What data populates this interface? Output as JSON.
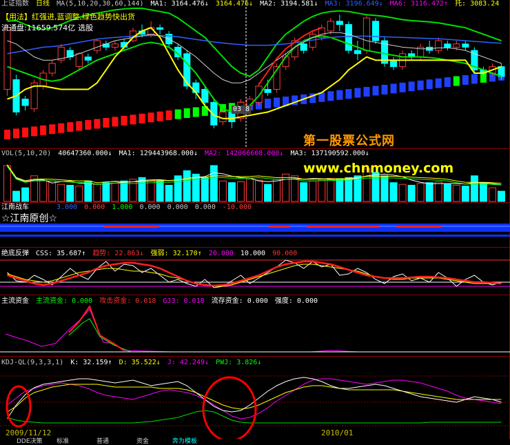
{
  "main": {
    "header_index": "上证指数",
    "header_period": "日线",
    "header_ma": "MA(5,10,20,30,60,144)",
    "ma1": "MA1: 3164.476↓",
    "ma1_value": "3164.476↓",
    "ma2": "MA2: 3194.581↓",
    "ma3": "MA3: 3196.649↓",
    "ma6": "MA6: 3116.472↑",
    "tuo": "托: 3083.24",
    "usage": "【用法】红强进,蓝调整,绿色趋势快出货",
    "float": "流通盘:11659.574亿",
    "select": "选股",
    "crosshair_label": "03 8"
  },
  "vol": {
    "label": "VOL(5,10,20)",
    "value": "40647360.000↓",
    "ma1": "MA1: 129443968.000↓",
    "ma2": "MA2: 142066608.000↓",
    "ma3": "MA3: 137190592.000↓"
  },
  "jiangnan": {
    "label": "江南战车",
    "values": [
      "3.000",
      "0.000",
      "1.000",
      "0.000",
      "0.000",
      "0.000",
      "-10.000"
    ],
    "subtitle": "☆江南原创☆"
  },
  "juedi": {
    "label": "绝底反弹",
    "css": "CSS: 35.687↑",
    "qushi": "趋势: 22.863↓",
    "qiangruo": "强弱: 32.170↑",
    "l1": "20.000",
    "l2": "10.000",
    "l3": "90.000"
  },
  "zhuliu": {
    "label": "主流资金",
    "zl": "主流资金: 0.000",
    "gj": "攻击资金: 0.018",
    "gj3": "GJ3: 0.018",
    "lc": "流存资金: 0.000",
    "qd": "强度: 0.000"
  },
  "kdj": {
    "label": "KDJ-QL(9,3,3,1)",
    "k": "K: 32.159↑",
    "d": "D: 35.522↓",
    "j": "J: 42.249↓",
    "pwj": "PWJ: 3.826↓"
  },
  "dates": [
    "2009/11/12",
    "2010/01"
  ],
  "watermark": {
    "name": "第一股票公式网",
    "url": "www.chnmoney.com"
  },
  "tabs": [
    "DDE决策",
    "标准",
    "普通",
    "资金",
    "奔为模板"
  ],
  "colors": {
    "up": "#ff3b3b",
    "down": "#00ffff",
    "ma_white": "#ffffff",
    "ma_yellow": "#ffff00",
    "ma_green": "#00e000",
    "ma_blue": "#3060ff",
    "border": "#8b0000"
  },
  "chart_data": [
    {
      "type": "candlestick",
      "title": "上证指数 日线",
      "candles": [
        [
          3050,
          3240,
          3030,
          3250
        ],
        [
          3080,
          2980,
          2970,
          3095
        ],
        [
          3020,
          3000,
          2985,
          3030
        ],
        [
          2990,
          3070,
          2980,
          3080
        ],
        [
          3060,
          3100,
          3050,
          3110
        ],
        [
          3100,
          3130,
          3090,
          3140
        ],
        [
          3140,
          3180,
          3130,
          3190
        ],
        [
          3170,
          3150,
          3140,
          3180
        ],
        [
          3120,
          3160,
          3110,
          3165
        ],
        [
          3150,
          3140,
          3130,
          3160
        ],
        [
          3170,
          3200,
          3160,
          3205
        ],
        [
          3190,
          3180,
          3170,
          3200
        ],
        [
          3180,
          3190,
          3170,
          3200
        ],
        [
          3195,
          3180,
          3170,
          3205
        ],
        [
          3200,
          3230,
          3195,
          3240
        ],
        [
          3230,
          3220,
          3210,
          3250
        ],
        [
          3220,
          3240,
          3210,
          3260
        ],
        [
          3240,
          3235,
          3220,
          3250
        ],
        [
          3220,
          3190,
          3180,
          3230
        ],
        [
          3180,
          3150,
          3140,
          3190
        ],
        [
          3160,
          3060,
          3050,
          3170
        ],
        [
          3070,
          3040,
          3020,
          3080
        ],
        [
          3050,
          3010,
          3000,
          3060
        ],
        [
          3010,
          2940,
          2930,
          3020
        ],
        [
          2950,
          2980,
          2940,
          2990
        ],
        [
          2980,
          2950,
          2930,
          3000
        ],
        [
          2960,
          3010,
          2950,
          3020
        ],
        [
          3000,
          3020,
          2990,
          3030
        ],
        [
          3010,
          3060,
          3000,
          3070
        ],
        [
          3050,
          3040,
          3030,
          3080
        ],
        [
          3050,
          3120,
          3040,
          3130
        ],
        [
          3120,
          3150,
          3110,
          3160
        ],
        [
          3150,
          3200,
          3140,
          3210
        ],
        [
          3190,
          3170,
          3160,
          3200
        ],
        [
          3180,
          3220,
          3170,
          3230
        ],
        [
          3210,
          3240,
          3200,
          3250
        ],
        [
          3230,
          3260,
          3220,
          3270
        ],
        [
          3260,
          3250,
          3230,
          3280
        ],
        [
          3250,
          3170,
          3160,
          3260
        ],
        [
          3170,
          3160,
          3140,
          3200
        ],
        [
          3170,
          3270,
          3160,
          3280
        ],
        [
          3260,
          3200,
          3190,
          3270
        ],
        [
          3200,
          3130,
          3120,
          3210
        ],
        [
          3140,
          3120,
          3110,
          3150
        ],
        [
          3120,
          3160,
          3110,
          3170
        ],
        [
          3160,
          3150,
          3140,
          3170
        ],
        [
          3150,
          3180,
          3140,
          3190
        ],
        [
          3180,
          3170,
          3160,
          3200
        ],
        [
          3170,
          3200,
          3160,
          3210
        ],
        [
          3190,
          3180,
          3170,
          3200
        ],
        [
          3180,
          3190,
          3170,
          3200
        ],
        [
          3190,
          3180,
          3170,
          3200
        ],
        [
          3170,
          3110,
          3100,
          3180
        ],
        [
          3110,
          3100,
          3090,
          3120
        ],
        [
          3100,
          3120,
          3090,
          3130
        ],
        [
          3120,
          3090,
          3080,
          3130
        ]
      ],
      "ylim": [
        2900,
        3300
      ]
    },
    {
      "type": "bar",
      "title": "VOL(5,10,20)",
      "values": [
        210,
        60,
        80,
        150,
        130,
        120,
        100,
        95,
        90,
        120,
        100,
        110,
        115,
        120,
        130,
        140,
        125,
        120,
        95,
        150,
        180,
        160,
        140,
        210,
        120,
        110,
        115,
        130,
        125,
        100,
        130,
        160,
        150,
        110,
        120,
        125,
        135,
        130,
        140,
        150,
        190,
        170,
        150,
        110,
        100,
        95,
        105,
        110,
        115,
        100,
        95,
        90,
        150,
        110,
        80,
        60
      ],
      "ylim": [
        0,
        250
      ]
    }
  ]
}
